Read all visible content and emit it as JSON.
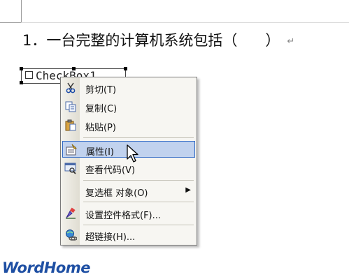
{
  "document": {
    "question_number": "1．",
    "question_text": "一台完整的计算机系统包括（",
    "question_end": "）",
    "paragraph_mark": "↵",
    "checkbox_label": "CheckBox1"
  },
  "context_menu": {
    "items": [
      {
        "label": "剪切(T)",
        "icon": "scissors-icon"
      },
      {
        "label": "复制(C)",
        "icon": "copy-icon"
      },
      {
        "label": "粘贴(P)",
        "icon": "paste-icon"
      },
      {
        "label": "属性(I)",
        "icon": "properties-icon",
        "selected": true
      },
      {
        "label": "查看代码(V)",
        "icon": "view-code-icon"
      },
      {
        "label": "复选框 对象(O)",
        "submenu_arrow": "▶"
      },
      {
        "label": "设置控件格式(F)...",
        "icon": "format-control-icon"
      },
      {
        "label": "超链接(H)...",
        "icon": "hyperlink-icon"
      }
    ]
  },
  "watermark": "WordHome",
  "colors": {
    "menu_highlight": "#c1d2ee",
    "menu_highlight_border": "#316ac5",
    "watermark": "#1e4fa3"
  }
}
